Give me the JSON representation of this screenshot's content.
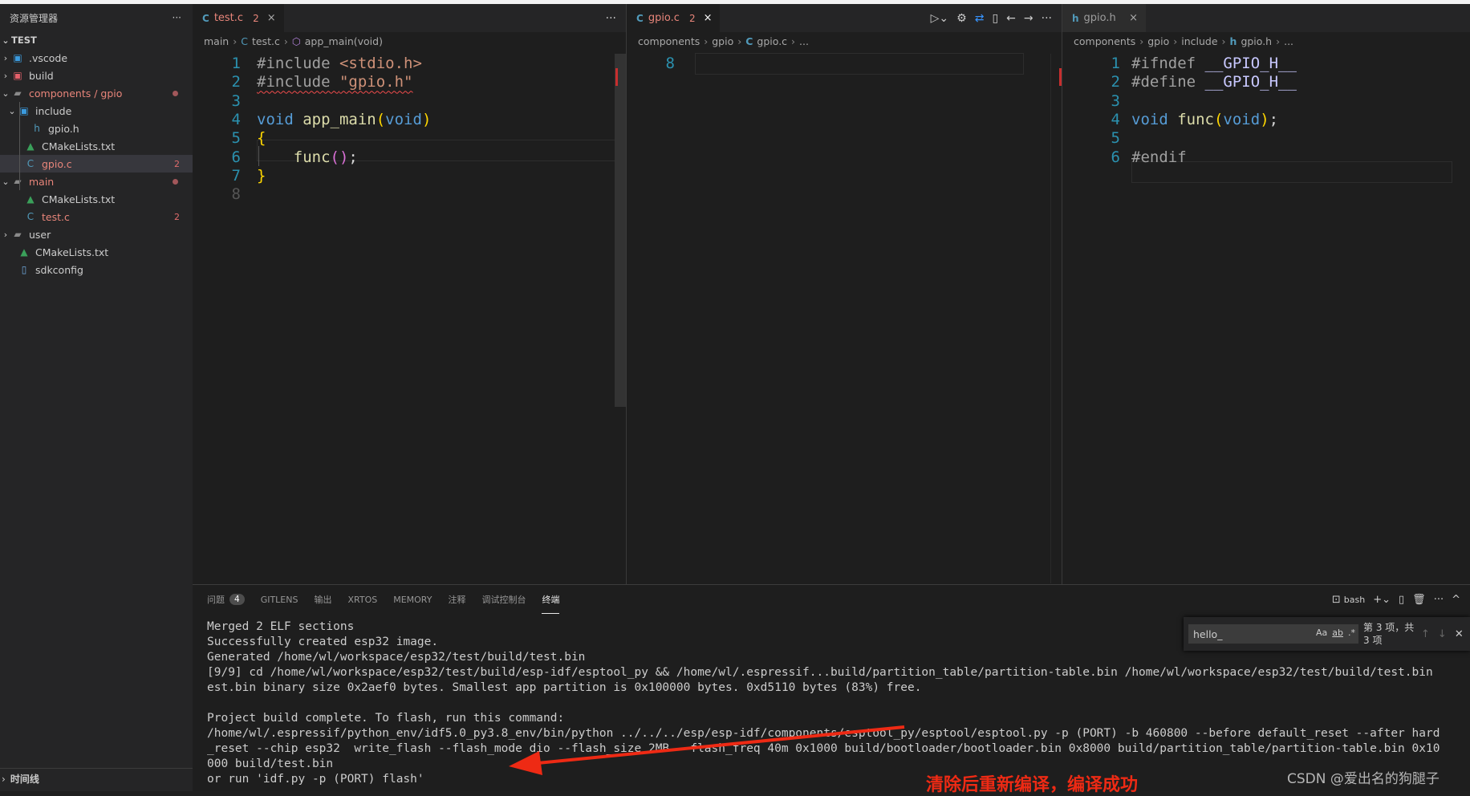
{
  "sidebar": {
    "title": "资源管理器",
    "more": "···",
    "root": "TEST",
    "items": [
      {
        "label": ".vscode",
        "icon": "vscode-folder-icon",
        "badge": ""
      },
      {
        "label": "build",
        "icon": "build-folder-icon",
        "badge": ""
      },
      {
        "label": "components / gpio",
        "icon": "folder-open-icon",
        "badge": ""
      },
      {
        "label": "include",
        "icon": "include-folder-icon",
        "badge": ""
      },
      {
        "label": "gpio.h",
        "icon": "h-file-icon",
        "badge": ""
      },
      {
        "label": "CMakeLists.txt",
        "icon": "cmake-icon",
        "badge": ""
      },
      {
        "label": "gpio.c",
        "icon": "c-file-icon",
        "badge": "2"
      },
      {
        "label": "main",
        "icon": "folder-open-icon",
        "badge": ""
      },
      {
        "label": "CMakeLists.txt",
        "icon": "cmake-icon",
        "badge": ""
      },
      {
        "label": "test.c",
        "icon": "c-file-icon",
        "badge": "2"
      },
      {
        "label": "user",
        "icon": "folder-icon",
        "badge": ""
      },
      {
        "label": "CMakeLists.txt",
        "icon": "cmake-icon",
        "badge": ""
      },
      {
        "label": "sdkconfig",
        "icon": "file-icon",
        "badge": ""
      }
    ],
    "timeline": "时间线"
  },
  "editors": [
    {
      "tab": {
        "icon": "C",
        "name": "test.c",
        "badge": "2"
      },
      "breadcrumb": [
        "main",
        "test.c",
        "app_main(void)"
      ],
      "lines": [
        {
          "n": "1",
          "tokens": [
            {
              "t": "#include ",
              "c": "#a0a0a0"
            },
            {
              "t": "<stdio.h>",
              "c": "#ce9178"
            }
          ]
        },
        {
          "n": "2",
          "tokens": [
            {
              "t": "#include ",
              "c": "#a0a0a0",
              "sq": true
            },
            {
              "t": "\"gpio.h\"",
              "c": "#ce9178",
              "sq": true
            }
          ]
        },
        {
          "n": "3",
          "tokens": []
        },
        {
          "n": "4",
          "tokens": [
            {
              "t": "void ",
              "c": "#569cd6"
            },
            {
              "t": "app_main",
              "c": "#dcdcaa"
            },
            {
              "t": "(",
              "c": "#ffd700"
            },
            {
              "t": "void",
              "c": "#569cd6"
            },
            {
              "t": ")",
              "c": "#ffd700"
            }
          ]
        },
        {
          "n": "5",
          "tokens": [
            {
              "t": "{",
              "c": "#ffd700"
            }
          ]
        },
        {
          "n": "6",
          "tokens": [
            {
              "t": "    func",
              "c": "#dcdcaa"
            },
            {
              "t": "()",
              "c": "#da70d6"
            },
            {
              "t": ";",
              "c": "#d4d4d4"
            }
          ]
        },
        {
          "n": "7",
          "tokens": [
            {
              "t": "}",
              "c": "#ffd700"
            }
          ]
        },
        {
          "n": "8",
          "tokens": []
        }
      ]
    },
    {
      "tab": {
        "icon": "C",
        "name": "gpio.c",
        "badge": "2"
      },
      "breadcrumb": [
        "components",
        "gpio",
        "gpio.c",
        "..."
      ],
      "lines": [
        {
          "n": "8",
          "tokens": []
        }
      ]
    },
    {
      "tab": {
        "icon": "h",
        "name": "gpio.h",
        "badge": ""
      },
      "breadcrumb": [
        "components",
        "gpio",
        "include",
        "gpio.h",
        "..."
      ],
      "lines": [
        {
          "n": "1",
          "tokens": [
            {
              "t": "#ifndef ",
              "c": "#a0a0a0"
            },
            {
              "t": "__GPIO_H__",
              "c": "#c8c8ff"
            }
          ]
        },
        {
          "n": "2",
          "tokens": [
            {
              "t": "#define ",
              "c": "#a0a0a0"
            },
            {
              "t": "__GPIO_H__",
              "c": "#c8c8ff"
            }
          ]
        },
        {
          "n": "3",
          "tokens": []
        },
        {
          "n": "4",
          "tokens": [
            {
              "t": "void ",
              "c": "#569cd6"
            },
            {
              "t": "func",
              "c": "#dcdcaa"
            },
            {
              "t": "(",
              "c": "#ffd700"
            },
            {
              "t": "void",
              "c": "#569cd6"
            },
            {
              "t": ")",
              "c": "#ffd700"
            },
            {
              "t": ";",
              "c": "#d4d4d4"
            }
          ]
        },
        {
          "n": "5",
          "tokens": []
        },
        {
          "n": "6",
          "tokens": [
            {
              "t": "#endif",
              "c": "#a0a0a0"
            }
          ]
        }
      ]
    }
  ],
  "panel": {
    "tabs": [
      {
        "label": "问题",
        "count": "4"
      },
      {
        "label": "GITLENS"
      },
      {
        "label": "输出"
      },
      {
        "label": "XRTOS"
      },
      {
        "label": "MEMORY"
      },
      {
        "label": "注释"
      },
      {
        "label": "调试控制台"
      },
      {
        "label": "终端",
        "active": true
      }
    ],
    "shell": "bash",
    "terminal_lines": [
      "Merged 2 ELF sections",
      "Successfully created esp32 image.",
      "Generated /home/wl/workspace/esp32/test/build/test.bin",
      "[9/9] cd /home/wl/workspace/esp32/test/build/esp-idf/esptool_py && /home/wl/.espressif...build/partition_table/partition-table.bin /home/wl/workspace/esp32/test/build/test.bin",
      "est.bin binary size 0x2aef0 bytes. Smallest app partition is 0x100000 bytes. 0xd5110 bytes (83%) free.",
      "",
      "Project build complete. To flash, run this command:",
      "/home/wl/.espressif/python_env/idf5.0_py3.8_env/bin/python ../../../esp/esp-idf/components/esptool_py/esptool/esptool.py -p (PORT) -b 460800 --before default_reset --after hard",
      "_reset --chip esp32  write_flash --flash_mode dio --flash_size 2MB --flash_freq 40m 0x1000 build/bootloader/bootloader.bin 0x8000 build/partition_table/partition-table.bin 0x10",
      "000 build/test.bin",
      "or run 'idf.py -p (PORT) flash'"
    ],
    "find": {
      "value": "hello_",
      "count": "第 3 项，共 3 项",
      "opts": [
        "Aa",
        "ab",
        ".*"
      ]
    }
  },
  "annotation": "清除后重新编译，编译成功",
  "watermark": "CSDN @爱出名的狗腿子",
  "colors": {
    "accent_red": "#ee2a14",
    "error": "#e8857a",
    "line_number": "#2b91af"
  }
}
